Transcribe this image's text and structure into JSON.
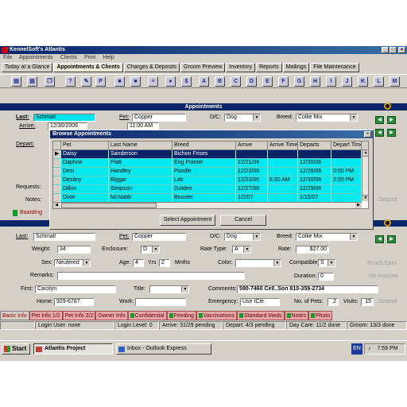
{
  "window": {
    "title": "KennelSoft's Atlantis",
    "menu": [
      "File",
      "Appointments",
      "Clients",
      "Print",
      "Help"
    ],
    "tabs": [
      "Today at a Glance",
      "Appointments & Clients",
      "Charges & Deposits",
      "Groom Preview",
      "Inventory",
      "Reports",
      "Mailings",
      "File Maintenance"
    ],
    "active_tab": "Appointments & Clients",
    "toolbar_letters": [
      "A",
      "B",
      "C",
      "D",
      "E",
      "F",
      "G",
      "H",
      "I",
      "J",
      "K",
      "L",
      "M"
    ]
  },
  "appointments_section": {
    "title": "Appointments",
    "last_label": "Last:",
    "last_value": "Schmall",
    "pet_label": "Pet:",
    "pet_value": "Copper",
    "dc_label": "D/C:",
    "dc_value": "Dog",
    "breed_label": "Breed:",
    "breed_value": "Collie Mix",
    "arrive_label": "Arrive:",
    "arrive_value": "12/30/2006",
    "arrive_time": "11:00 AM",
    "depart_label": "Depart:",
    "requests_label": "Requests:",
    "notes_label": "Notes:",
    "boarding_label": "Boarding",
    "deposit_label": "Deposit"
  },
  "dialog": {
    "title": "Browse Appointments",
    "columns": [
      "Pet",
      "Last Name",
      "Breed",
      "Arrive",
      "Arrive Time",
      "Departs",
      "Depart Time"
    ],
    "rows": [
      {
        "pet": "Daisy",
        "last": "Sanderson",
        "breed": "Bichon Frises",
        "arrive": "",
        "arrive_time": "",
        "departs": "",
        "depart_time": "",
        "selected": true
      },
      {
        "pet": "Daphne",
        "last": "Platt",
        "breed": "Eng Pointer",
        "arrive": "12/21/06",
        "arrive_time": "",
        "departs": "12/30/06",
        "depart_time": ""
      },
      {
        "pet": "Desi",
        "last": "Handley",
        "breed": "Poodle",
        "arrive": "12/23/06",
        "arrive_time": "",
        "departs": "12/26/06",
        "depart_time": "0:00 PM"
      },
      {
        "pet": "Destiny",
        "last": "Biggar",
        "breed": "Lab",
        "arrive": "12/23/06",
        "arrive_time": "8:30 AM",
        "departs": "12/30/06",
        "depart_time": "2:00 PM"
      },
      {
        "pet": "Dillon",
        "last": "Simpson",
        "breed": "Golden",
        "arrive": "12/27/06",
        "arrive_time": "",
        "departs": "12/29/06",
        "depart_time": ""
      },
      {
        "pet": "Dixie",
        "last": "McNabb",
        "breed": "Bouvier",
        "arrive": "1/2/07",
        "arrive_time": "",
        "departs": "1/15/07",
        "depart_time": ""
      }
    ],
    "select_button": "Select Appointment",
    "cancel_button": "Cancel"
  },
  "client_section": {
    "last_label": "Last:",
    "last_value": "Schmall",
    "pet_label": "Pet:",
    "pet_value": "Copper",
    "dc_label": "D/C:",
    "dc_value": "Dog",
    "breed_label": "Breed:",
    "breed_value": "Collie Mix",
    "weight_label": "Weight:",
    "weight_value": "34",
    "enclosure_label": "Enclosure:",
    "enclosure_value": "D",
    "rate_type_label": "Rate Type:",
    "rate_type_value": "A",
    "rate_label": "Rate:",
    "rate_value": "$27.00",
    "sex_label": "Sex:",
    "sex_value": "Neutered",
    "age_label": "Age:",
    "age_value": "4",
    "yrs_label": "Yrs",
    "months_value": "2",
    "mnths_label": "Mnths",
    "color_label": "Color:",
    "color_value": "",
    "compatible_label": "Compatible:",
    "compatible_value": "S",
    "remarks_label": "Remarks:",
    "duration_label": "Duration:",
    "duration_value": "0",
    "first_label": "First:",
    "first_value": "Carolyn",
    "title_label": "Title:",
    "comments_label": "Comments:",
    "comments_value": "590-7460 Cell..Son 810-359-2734",
    "home_label": "Home:",
    "home_value": "929-6787",
    "work_label": "Work:",
    "emergency_label": "Emergency:",
    "emergency_value": "Use ICle",
    "pets_label": "No. of Pets:",
    "pets_value": "2",
    "visits_label": "Visits:",
    "visits_value": "15",
    "deposit_label": "Deposit",
    "punch_card": "Punch Card",
    "on_account": "On Account"
  },
  "bottom_tabs": [
    "Basic Info",
    "Pet Info 1/2",
    "Pet Info 2/2",
    "Owner Info",
    "Confidential",
    "Feeding",
    "Vaccinations",
    "Standard Meds",
    "Notes",
    "Photo"
  ],
  "status_bar": [
    "Login User: none",
    "Login Level: 0",
    "Arrive: 31/29 pending",
    "Depart: 4/3 pending",
    "Day Care: 11/2 done",
    "Groom: 13/3 done"
  ],
  "taskbar": {
    "start": "Start",
    "items": [
      "Atlantis Project",
      "Inbox - Outlook Express"
    ],
    "lang": "EN",
    "time": "7:59 PM"
  }
}
